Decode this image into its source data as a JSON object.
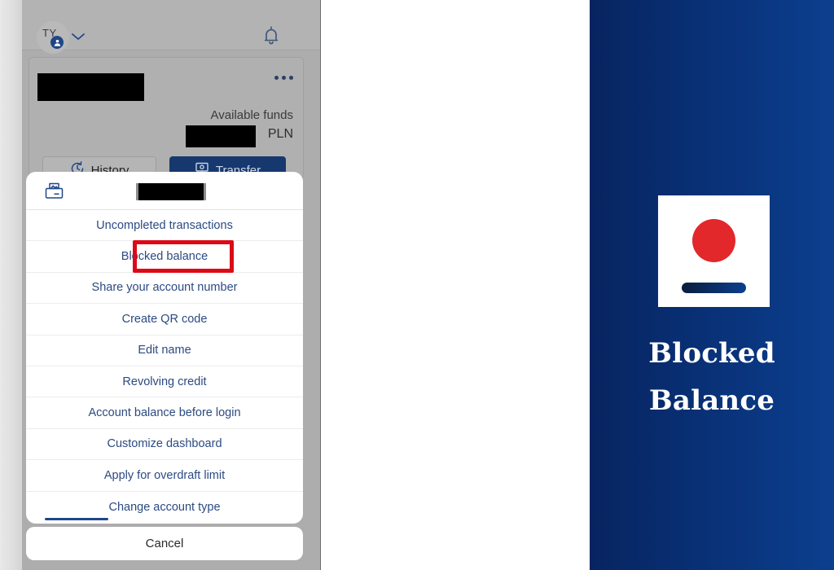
{
  "app": {
    "header": {
      "avatar_initials": "TY",
      "avatar_icon": "person-badge-icon",
      "chevron_icon": "chevron-down-icon",
      "notifications_icon": "bell-icon"
    },
    "account_card": {
      "account_name_redacted": "",
      "more_icon": "ellipsis-icon",
      "available_funds_label": "Available funds",
      "amount_redacted": "",
      "currency": "PLN",
      "history_button": "History",
      "history_icon": "clock-history-icon",
      "transfer_button": "Transfer",
      "transfer_icon": "money-transfer-icon"
    }
  },
  "action_sheet": {
    "header_icon": "wallet-card-icon",
    "header_title_redacted": "",
    "items": [
      {
        "label": "Uncompleted transactions",
        "highlighted": false
      },
      {
        "label": "Blocked balance",
        "highlighted": true
      },
      {
        "label": "Share your account number",
        "highlighted": false
      },
      {
        "label": "Create QR code",
        "highlighted": false
      },
      {
        "label": "Edit name",
        "highlighted": false
      },
      {
        "label": "Revolving credit",
        "highlighted": false
      },
      {
        "label": "Account balance before login",
        "highlighted": false
      },
      {
        "label": "Customize dashboard",
        "highlighted": false
      },
      {
        "label": "Apply for overdraft limit",
        "highlighted": false
      },
      {
        "label": "Change account type",
        "highlighted": false
      }
    ],
    "cancel_label": "Cancel"
  },
  "title_card": {
    "title_line1": "Blocked",
    "title_line2": "Balance",
    "thumbnail_icon": "red-circle-bar-thumbnail"
  },
  "colors": {
    "highlight_red": "#dc0a17",
    "brand_navy": "#16386e",
    "menu_text_blue": "#2b4a82",
    "accent_red": "#e2282a",
    "panel_gradient_start": "#072460",
    "panel_gradient_end": "#0b3f8f",
    "redaction": "#000000"
  }
}
